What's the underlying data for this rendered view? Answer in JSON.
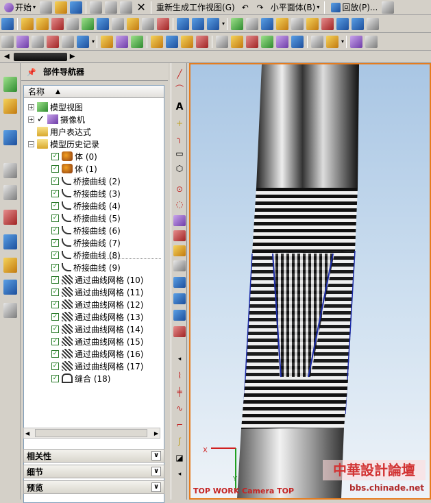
{
  "menubar": {
    "start_label": "开始",
    "regen_label": "重新生成工作视图(G)",
    "small_plane_label": "小平面体(B)",
    "replay_label": "回放(P)..."
  },
  "navigator": {
    "title": "部件导航器",
    "column_name": "名称",
    "items": [
      {
        "label": "模型视图",
        "level": 0,
        "expander": "+",
        "icon": "view-icon",
        "check": false
      },
      {
        "label": "摄像机",
        "level": 0,
        "expander": "+",
        "icon": "camera-icon",
        "check": true
      },
      {
        "label": "用户表达式",
        "level": 0,
        "expander": "",
        "icon": "folder-icon",
        "check": false
      },
      {
        "label": "模型历史记录",
        "level": 0,
        "expander": "−",
        "icon": "folder-open-icon",
        "check": false
      },
      {
        "label": "体 (0)",
        "level": 1,
        "icon": "body-icon",
        "check": true
      },
      {
        "label": "体 (1)",
        "level": 1,
        "icon": "body-icon",
        "check": true
      },
      {
        "label": "桥接曲线 (2)",
        "level": 1,
        "icon": "bridge-curve-icon",
        "check": true
      },
      {
        "label": "桥接曲线 (3)",
        "level": 1,
        "icon": "bridge-curve-icon",
        "check": true
      },
      {
        "label": "桥接曲线 (4)",
        "level": 1,
        "icon": "bridge-curve-icon",
        "check": true
      },
      {
        "label": "桥接曲线 (5)",
        "level": 1,
        "icon": "bridge-curve-icon",
        "check": true
      },
      {
        "label": "桥接曲线 (6)",
        "level": 1,
        "icon": "bridge-curve-icon",
        "check": true
      },
      {
        "label": "桥接曲线 (7)",
        "level": 1,
        "icon": "bridge-curve-icon",
        "check": true
      },
      {
        "label": "桥接曲线 (8)",
        "level": 1,
        "icon": "bridge-curve-icon",
        "check": true
      },
      {
        "label": "桥接曲线 (9)",
        "level": 1,
        "icon": "bridge-curve-icon",
        "check": true
      },
      {
        "label": "通过曲线网格 (10)",
        "level": 1,
        "icon": "curve-mesh-icon",
        "check": true
      },
      {
        "label": "通过曲线网格 (11)",
        "level": 1,
        "icon": "curve-mesh-icon",
        "check": true
      },
      {
        "label": "通过曲线网格 (12)",
        "level": 1,
        "icon": "curve-mesh-icon",
        "check": true
      },
      {
        "label": "通过曲线网格 (13)",
        "level": 1,
        "icon": "curve-mesh-icon",
        "check": true
      },
      {
        "label": "通过曲线网格 (14)",
        "level": 1,
        "icon": "curve-mesh-icon",
        "check": true
      },
      {
        "label": "通过曲线网格 (15)",
        "level": 1,
        "icon": "curve-mesh-icon",
        "check": true
      },
      {
        "label": "通过曲线网格 (16)",
        "level": 1,
        "icon": "curve-mesh-icon",
        "check": true
      },
      {
        "label": "通过曲线网格 (17)",
        "level": 1,
        "icon": "curve-mesh-icon",
        "check": true
      },
      {
        "label": "缝合 (18)",
        "level": 1,
        "icon": "sew-icon",
        "check": true
      }
    ]
  },
  "panels": {
    "dependencies": "相关性",
    "details": "细节",
    "preview": "预览"
  },
  "viewport": {
    "label": "TOP WORK Camera TOP",
    "axis_x": "X",
    "axis_y": "Y"
  },
  "watermark": {
    "name": "中華設計論壇",
    "url": "bbs.chinade.net"
  }
}
